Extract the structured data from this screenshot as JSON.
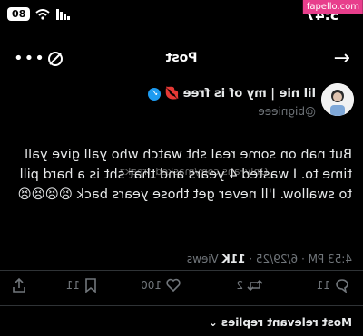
{
  "status": {
    "time": "5:47",
    "battery": "80"
  },
  "watermark": {
    "top": "fapello.com",
    "body": "OnlyFans.com/masked_freakz"
  },
  "header": {
    "title": "Post"
  },
  "author": {
    "display_name": "lil nie | my of is free",
    "handle": "@bignieee"
  },
  "post": {
    "text": "But nah on some real sht watch who yall give yall time to. I wasted 4 years and that sht is a hard pill to swallow. I'll never get those years back 😣😣😣😣",
    "time": "4:53 PM",
    "date": "6/29/25",
    "views_count": "11K",
    "views_label": "Views"
  },
  "actions": {
    "replies": "11",
    "reposts": "2",
    "likes": "100",
    "bookmarks": "11"
  },
  "footer": {
    "sort_label": "Most relevant replies"
  }
}
